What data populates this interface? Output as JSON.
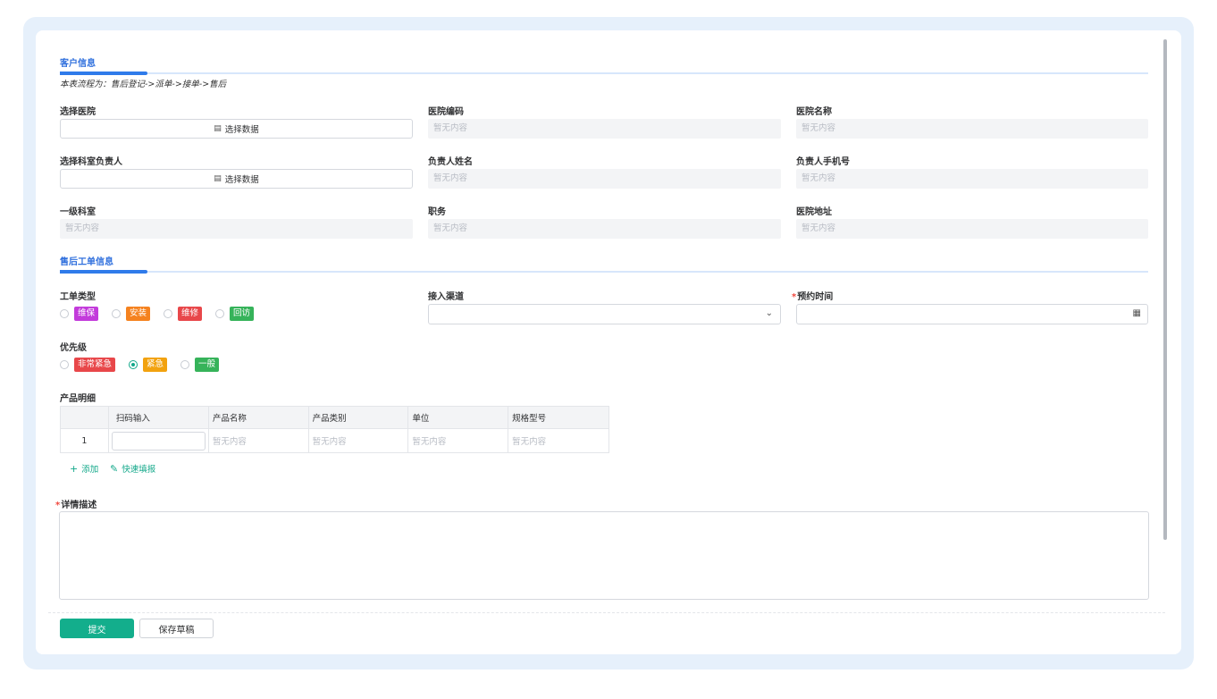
{
  "colors": {
    "accent": "#2f7bea",
    "primary": "#13ae8c",
    "tag_weibao": "#c33bdb",
    "tag_anzhuang": "#f5821f",
    "tag_weixiu": "#e8474a",
    "tag_huifang": "#36b35a",
    "tag_feichang": "#e8474a",
    "tag_jinji": "#f2a20f",
    "tag_yiban": "#36b35a"
  },
  "customer_section": {
    "title": "客户信息",
    "flow_note": "本表流程为：售后登记->派单->接单->售后",
    "select_hospital": {
      "label": "选择医院",
      "button": "选择数据",
      "icon": "database-icon"
    },
    "hospital_code": {
      "label": "医院编码",
      "value": "暂无内容"
    },
    "hospital_name": {
      "label": "医院名称",
      "value": "暂无内容"
    },
    "select_dept_head": {
      "label": "选择科室负责人",
      "button": "选择数据",
      "icon": "database-icon"
    },
    "head_name": {
      "label": "负责人姓名",
      "value": "暂无内容"
    },
    "head_phone": {
      "label": "负责人手机号",
      "value": "暂无内容"
    },
    "primary_dept": {
      "label": "一级科室",
      "value": "暂无内容"
    },
    "position": {
      "label": "职务",
      "value": "暂无内容"
    },
    "hospital_address": {
      "label": "医院地址",
      "value": "暂无内容"
    }
  },
  "order_section": {
    "title": "售后工单信息",
    "order_type": {
      "label": "工单类型",
      "options": [
        "维保",
        "安装",
        "维修",
        "回访"
      ]
    },
    "channel": {
      "label": "接入渠道",
      "value": "",
      "icon": "chevron-down-icon"
    },
    "appointment": {
      "required_mark": "*",
      "label": "预约时间",
      "value": "",
      "icon": "calendar-icon"
    },
    "priority": {
      "label": "优先级",
      "options": [
        "非常紧急",
        "紧急",
        "一般"
      ],
      "selected": "紧急"
    },
    "products": {
      "label": "产品明细",
      "columns": [
        "",
        "扫码输入",
        "产品名称",
        "产品类别",
        "单位",
        "规格型号"
      ],
      "rows": [
        {
          "index": "1",
          "scan": "",
          "name": "暂无内容",
          "category": "暂无内容",
          "unit": "暂无内容",
          "spec": "暂无内容"
        }
      ],
      "add_label": "添加",
      "quick_fill_label": "快速填报"
    },
    "description": {
      "required_mark": "*",
      "label": "详情描述",
      "value": ""
    }
  },
  "actions": {
    "submit": "提交",
    "save_draft": "保存草稿"
  }
}
